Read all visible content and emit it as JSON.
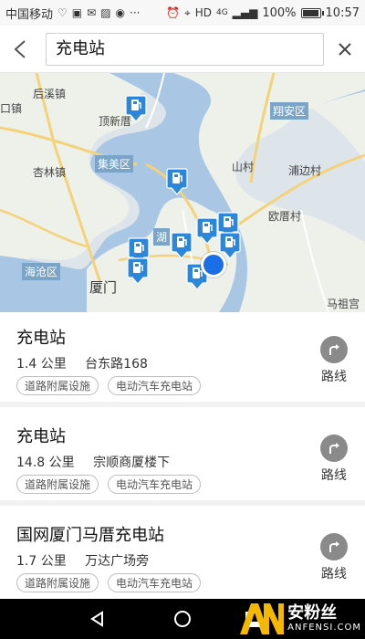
{
  "status_bar": {
    "carrier": "中国移动",
    "battery": "100%",
    "time": "10:57",
    "network": "4G",
    "hd": "HD",
    "battery_level": 1.0
  },
  "search": {
    "query": "充电站"
  },
  "map": {
    "labels": {
      "houxi": "后溪镇",
      "dingcun": "顶新厝",
      "kouzhen": "口镇",
      "xiangan": "翔安区",
      "xinglin": "杏林镇",
      "jimei": "集美区",
      "shancun": "山村",
      "pubian": "浦边村",
      "ouchuo": "欧厝村",
      "hu": "湖",
      "haicang": "海沧区",
      "xiamen": "厦门",
      "mazu": "马祖宫"
    }
  },
  "results": [
    {
      "name": "充电站",
      "distance": "1.4 公里",
      "address": "台东路168",
      "tags": [
        "道路附属设施",
        "电动汽车充电站"
      ],
      "route_label": "路线"
    },
    {
      "name": "充电站",
      "distance": "14.8 公里",
      "address": "宗顺商厦楼下",
      "tags": [
        "道路附属设施",
        "电动汽车充电站"
      ],
      "route_label": "路线"
    },
    {
      "name": "国网厦门马厝充电站",
      "distance": "1.7 公里",
      "address": "万达广场旁",
      "tags": [
        "道路附属设施",
        "电动汽车充电站"
      ],
      "route_label": "路线"
    }
  ],
  "watermark": {
    "logo": "AN",
    "cn": "安粉丝",
    "en": "ANFENSI.COM"
  },
  "colors": {
    "water": "#a9c7e4",
    "land": "#eef0ea",
    "road": "#f3d27a",
    "pin": "#2c86d9",
    "me": "#1b6fe6",
    "route_button": "#8a8a8a"
  }
}
